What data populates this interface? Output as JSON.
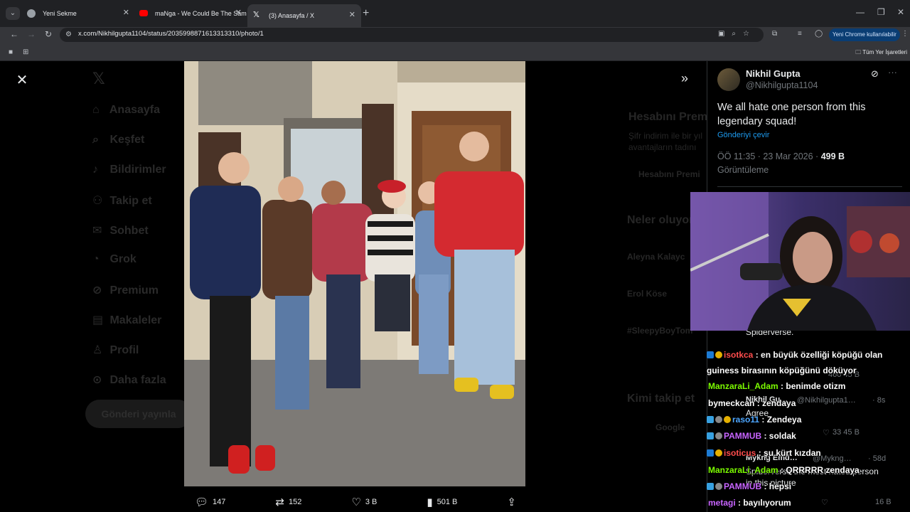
{
  "browser": {
    "tabs": [
      {
        "label": "Yeni Sekme"
      },
      {
        "label": "maNga - We Could Be The Sam"
      },
      {
        "label": "(3) Anasayfa / X"
      }
    ],
    "url": "x.com/Nikhilgupta1104/status/2035998871613313310/photo/1",
    "chrome_pill": "Yeni Chrome kullanılabilir",
    "bookmarks_all": "Tüm Yer İşaretleri"
  },
  "background_nav": [
    "Anasayfa",
    "Keşfet",
    "Bildirimler",
    "Takip et",
    "Sohbet",
    "Grok",
    "Premium",
    "Makaleler",
    "Profil",
    "Daha fazla"
  ],
  "background_post_button": "Gönderi yayınla",
  "background_right": {
    "premium_title": "Hesabını Premiu",
    "premium_body1": "Şifr indirim ile bir yıl",
    "premium_body2": "avantajların tadını",
    "premium_btn": "Hesabını Premi",
    "trends_title": "Neler oluyor",
    "trend1": "Aleyna Kalayc",
    "trend2": "Erol Köse",
    "trend3": "#SleepyBoyTom",
    "follow_title": "Kimi takip et",
    "follow1": "Google"
  },
  "photo_actions": {
    "replies": "147",
    "reposts": "152",
    "likes": "3 B",
    "views": "501 B"
  },
  "tweet": {
    "name": "Nikhil Gupta",
    "handle": "@Nikhilgupta1104",
    "text": "We all hate one person from this legendary squad!",
    "translate": "Gönderiyi çevir",
    "time": "ÖÖ 11:35 · 23 Mar 2026 · ",
    "views_count": "499 B",
    "views_label": "Görüntüleme"
  },
  "replies": [
    {
      "text": "Spiderverse."
    },
    {
      "stats": "460   45 B"
    },
    {
      "name": "Nikhil Gu…",
      "handle": "@Nikhilgupta1…",
      "time": "· 8s",
      "text": "Agree",
      "stats": "33   45 B"
    },
    {
      "name": "Mykng Emd…",
      "handle": "@Mykng…",
      "time": "· 58d",
      "text": "Spiderverse the most hated person",
      "text2": "in this picture",
      "stats": "16 B"
    }
  ],
  "chat": [
    {
      "user": "isotkca",
      "color": "#ff4d4d",
      "msg": " : en büyük özelliği köpüğü olan"
    },
    {
      "user": "",
      "color": "#ffffff",
      "msg": "guiness birasının köpüğünü döküyor"
    },
    {
      "user": "ManzaraLi_Adam",
      "color": "#7cfc00",
      "msg": " : benimde otizm"
    },
    {
      "user": "bymeckcan",
      "color": "#ffffff",
      "msg": " : zendaya"
    },
    {
      "user": "raso11",
      "color": "#4da6ff",
      "msg": " : Zendeya"
    },
    {
      "user": "PAMMUB",
      "color": "#c864ff",
      "msg": " : soldak"
    },
    {
      "user": "isoticus",
      "color": "#ff4d4d",
      "msg": " : şu kürt kızdan"
    },
    {
      "user": "ManzaraLi_Adam",
      "color": "#7cfc00",
      "msg": " : QRRRRR zendaya"
    },
    {
      "user": "PAMMUB",
      "color": "#c864ff",
      "msg": " : hepsi"
    },
    {
      "user": "metagi",
      "color": "#c864ff",
      "msg": " : bayılıyorum"
    }
  ],
  "colors": {
    "accent": "#1d9bf0",
    "bg": "#000000",
    "text": "#e7e9ea",
    "muted": "#71767b"
  }
}
